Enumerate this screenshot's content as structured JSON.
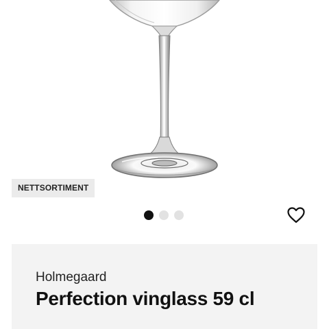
{
  "product": {
    "image_icon": "wine-glass-image",
    "badge": "NETTSORTIMENT",
    "brand": "Holmegaard",
    "title": "Perfection vinglass 59 cl"
  },
  "carousel": {
    "count": 3,
    "active_index": 0
  },
  "actions": {
    "favorite_icon": "heart-outline-icon"
  }
}
